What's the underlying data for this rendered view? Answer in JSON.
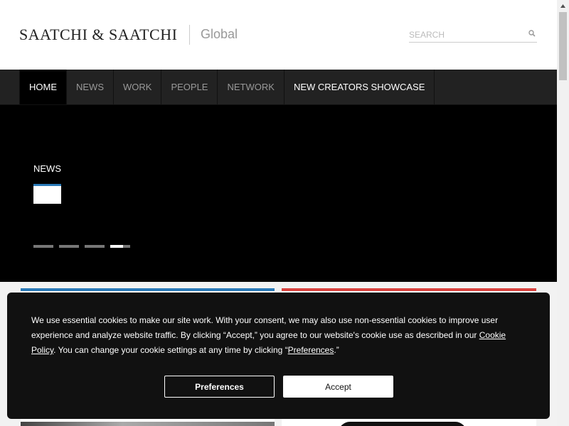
{
  "header": {
    "logo": "SAATCHI & SAATCHI",
    "region": "Global",
    "search": {
      "placeholder": "SEARCH"
    }
  },
  "nav": {
    "items": [
      {
        "label": "HOME",
        "active": true
      },
      {
        "label": "NEWS"
      },
      {
        "label": "WORK"
      },
      {
        "label": "PEOPLE"
      },
      {
        "label": "NETWORK"
      },
      {
        "label": "NEW CREATORS SHOWCASE"
      }
    ]
  },
  "hero": {
    "label": "NEWS",
    "slides_total": 4,
    "active_slide": 4
  },
  "cookie": {
    "text_before_link": "We use essential cookies to make our site work. With your consent, we may also use non-essential cookies to improve user experience and analyze website traffic. By clicking “Accept,” you agree to our website's cookie use as described in our ",
    "policy_link": "Cookie Policy",
    "text_middle": ". You can change your cookie settings at any time by clicking “",
    "preferences_link": "Preferences",
    "text_after": ".”",
    "preferences_button": "Preferences",
    "accept_button": "Accept"
  },
  "colors": {
    "accent_blue": "#2a7ab8",
    "accent_red": "#d9433f",
    "nav_bg": "#222222",
    "banner_bg": "#111111"
  }
}
